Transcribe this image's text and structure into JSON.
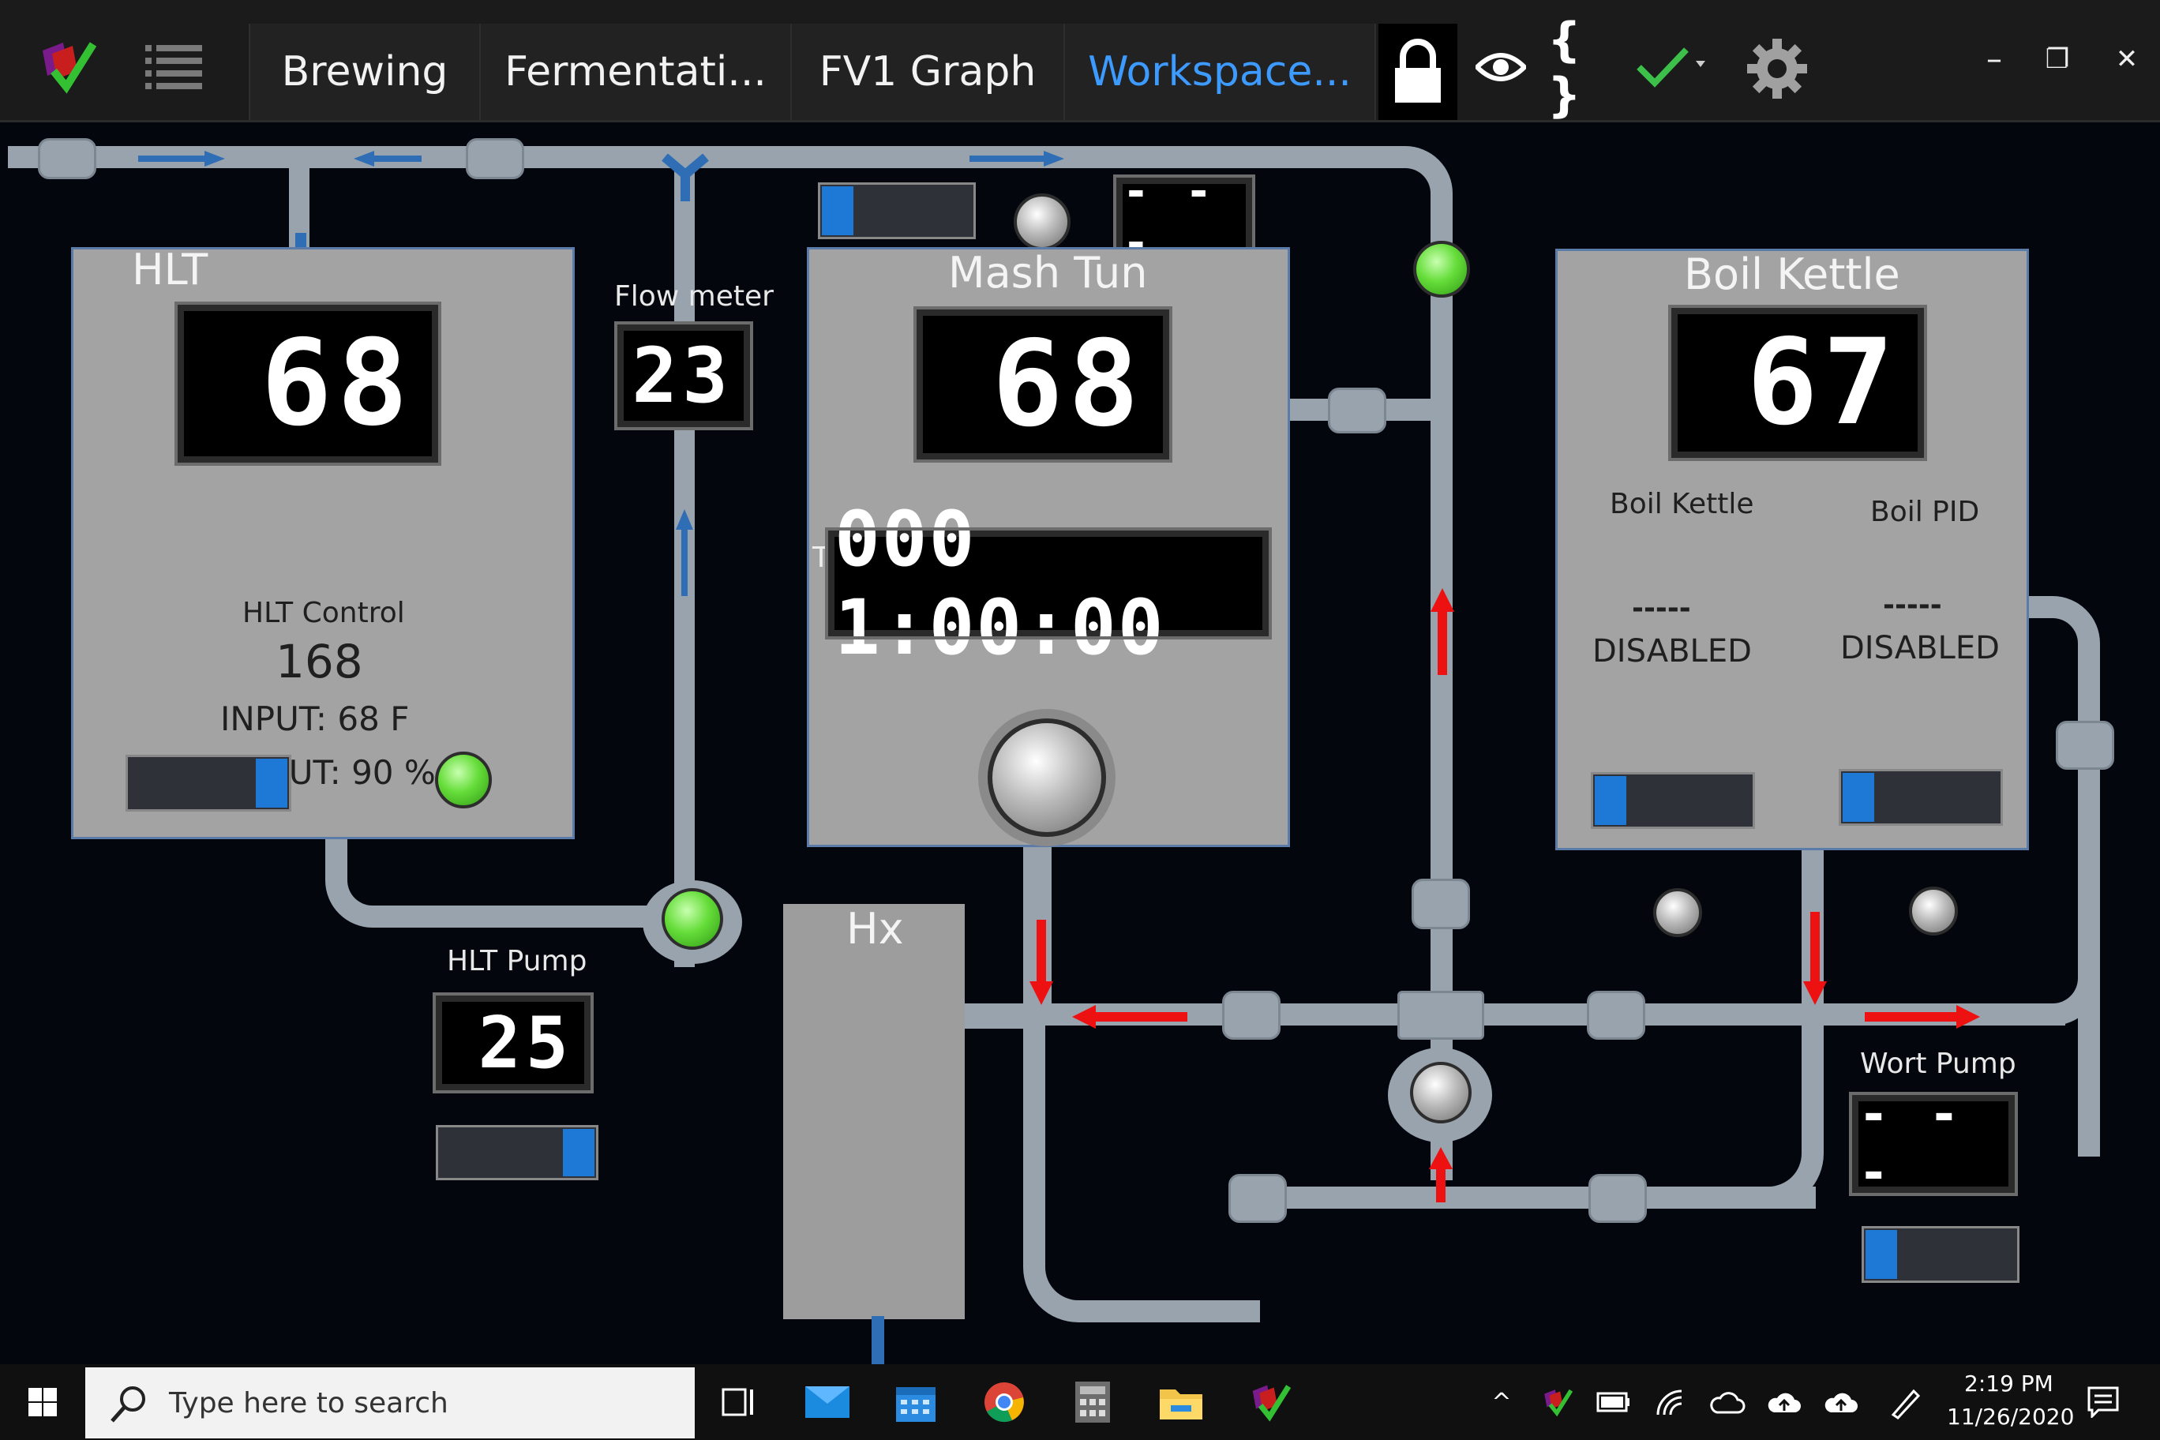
{
  "titlebar": {
    "tabs": [
      {
        "label": "Brewing"
      },
      {
        "label": "Fermentati..."
      },
      {
        "label": "FV1 Graph"
      },
      {
        "label": "Workspace..."
      }
    ],
    "window_controls": {
      "minimize": "–",
      "restore": "❐",
      "close": "✕"
    },
    "colors": {
      "active_tab": "#3d9bff",
      "check": "#3cc04a"
    }
  },
  "hlt": {
    "title": "HLT",
    "temp": "68",
    "control_label": "HLT Control",
    "setpoint": "168",
    "input": "INPUT: 68 F",
    "output": "OUTPUT: 90 %"
  },
  "flowmeter": {
    "label": "Flow meter",
    "value": "23"
  },
  "hlt_pump": {
    "label": "HLT Pump",
    "value": "25"
  },
  "mash_tun": {
    "title": "Mash Tun",
    "temp": "68",
    "timer": "000 1:00:00",
    "marker": "T",
    "top_display": "- - -"
  },
  "hx": {
    "title": "Hx"
  },
  "boil_kettle": {
    "title": "Boil Kettle",
    "temp": "67",
    "col1_label": "Boil Kettle",
    "col1_value": "-----",
    "col1_status": "DISABLED",
    "col2_label": "Boil PID",
    "col2_value": "-----",
    "col2_status": "DISABLED"
  },
  "wort_pump": {
    "label": "Wort Pump",
    "value": "- - -"
  },
  "taskbar": {
    "search_placeholder": "Type here to search",
    "time": "2:19 PM",
    "date": "11/26/2020"
  }
}
